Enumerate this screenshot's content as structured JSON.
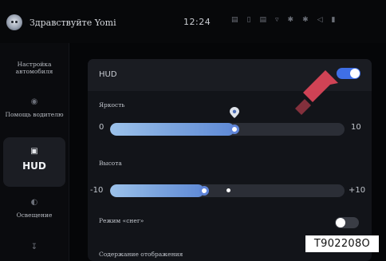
{
  "header": {
    "greeting": "Здравствуйте Yomi",
    "time": "12:24",
    "status_icons": [
      "wifi-icon",
      "phone-icon",
      "bluetooth-icon",
      "signal-icon",
      "fan-icon",
      "seat-icon",
      "speaker-icon",
      "bars-icon"
    ]
  },
  "sidebar": {
    "items": [
      {
        "label": "Настройка автомобиля",
        "icon": "car-icon",
        "active": false
      },
      {
        "label": "Помощь водителю",
        "icon": "steering-wheel-icon",
        "active": false
      },
      {
        "label": "HUD",
        "icon": "hud-icon",
        "active": true
      },
      {
        "label": "Освещение",
        "icon": "light-icon",
        "active": false
      },
      {
        "label": "",
        "icon": "seat-icon",
        "active": false
      }
    ]
  },
  "settings": {
    "hud": {
      "label": "HUD",
      "enabled": true
    },
    "brightness": {
      "label": "Яркость",
      "min": "0",
      "max": "10",
      "fraction": 0.53
    },
    "height": {
      "label": "Высота",
      "min": "-10",
      "max": "+10",
      "fraction": 0.4
    },
    "snow_mode": {
      "label": "Режим «снег»",
      "enabled": false
    },
    "display_content": {
      "label": "Содержание отображения"
    }
  },
  "watermark": "T902208O",
  "colors": {
    "accent": "#3f6fe6",
    "slider_fill": "#7ba4de",
    "arrow": "#e0475a"
  }
}
